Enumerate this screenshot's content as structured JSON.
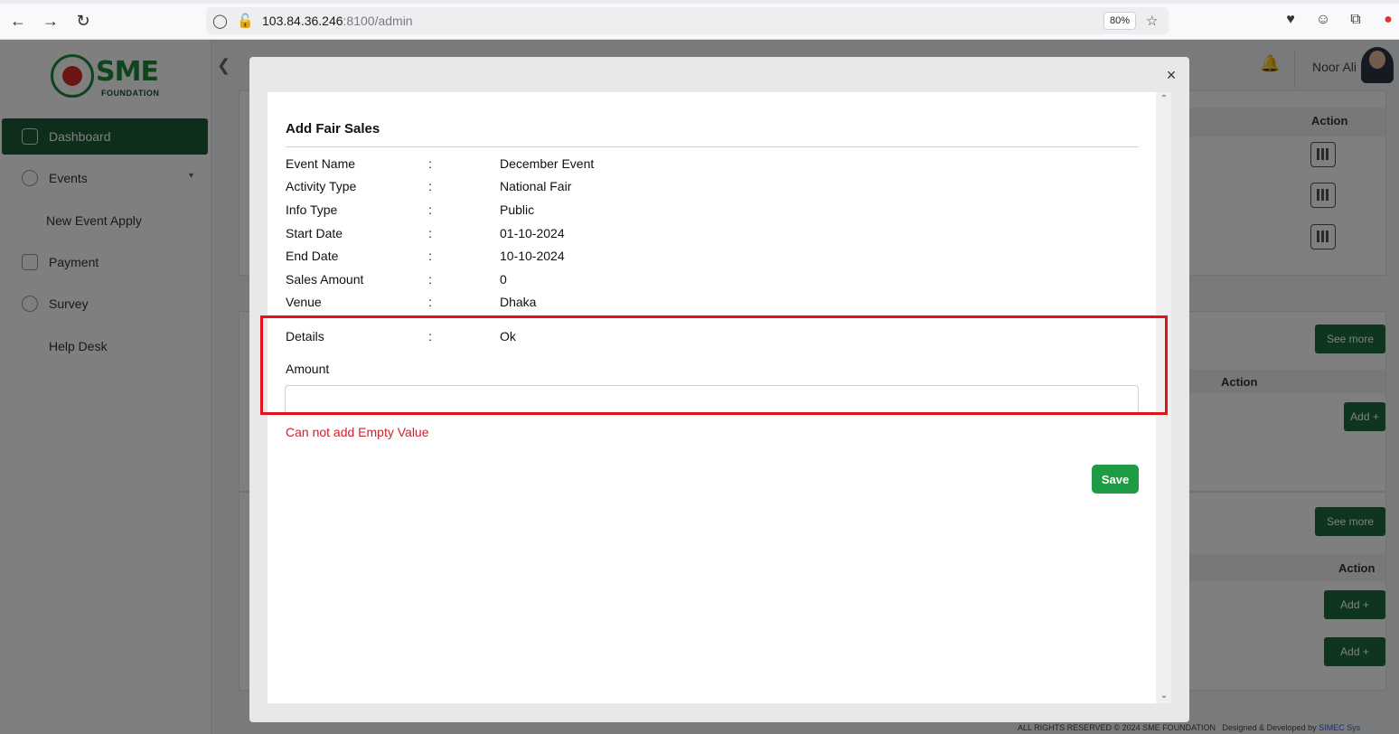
{
  "browser": {
    "url_host": "103.84.36.246",
    "url_port_path": ":8100/admin",
    "zoom": "80%"
  },
  "sidebar": {
    "logo_text": "SME",
    "logo_sub": "FOUNDATION",
    "items": [
      {
        "label": "Dashboard"
      },
      {
        "label": "Events"
      },
      {
        "label": "New Event Apply"
      },
      {
        "label": "Payment"
      },
      {
        "label": "Survey"
      },
      {
        "label": "Help Desk"
      }
    ]
  },
  "header": {
    "user_name": "Noor Ali"
  },
  "background": {
    "action_header": "Action",
    "see_more": "See more",
    "add_plus": "Add +"
  },
  "footer": {
    "copyright": "ALL RIGHTS RESERVED © 2024 SME FOUNDATION",
    "designed_by": "Designed & Developed by",
    "company": "SIMEC Sys"
  },
  "modal": {
    "title": "Add Fair Sales",
    "separator": ":",
    "fields": [
      {
        "label": "Event Name",
        "value": "December Event"
      },
      {
        "label": "Activity Type",
        "value": "National Fair"
      },
      {
        "label": "Info Type",
        "value": "Public"
      },
      {
        "label": "Start Date",
        "value": "01-10-2024"
      },
      {
        "label": "End Date",
        "value": "10-10-2024"
      },
      {
        "label": "Sales Amount",
        "value": "0"
      },
      {
        "label": "Venue",
        "value": "Dhaka"
      }
    ],
    "details": {
      "label": "Details",
      "value": "Ok"
    },
    "amount_label": "Amount",
    "amount_value": "",
    "error": "Can not add Empty Value",
    "save_label": "Save"
  }
}
